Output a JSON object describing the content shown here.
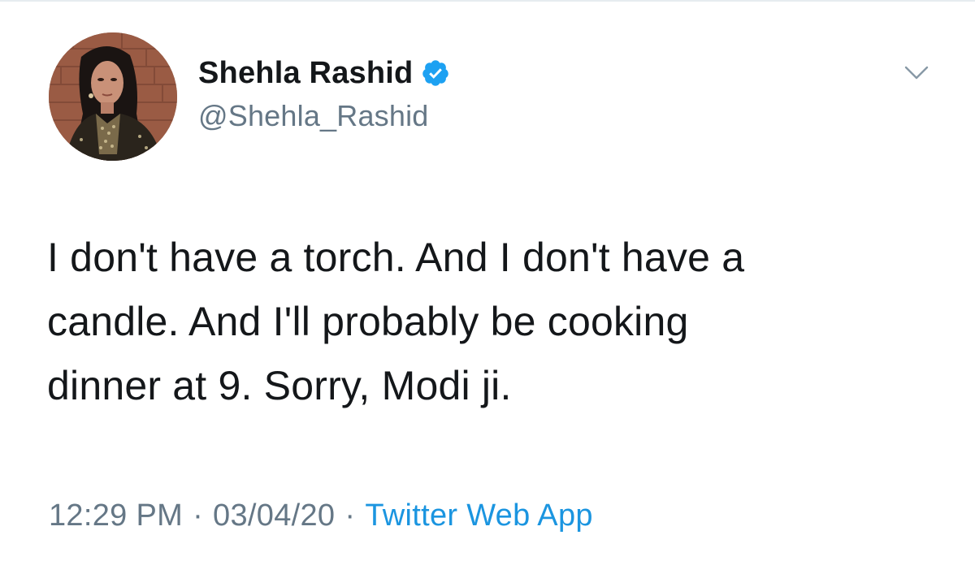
{
  "tweet": {
    "author": {
      "display_name": "Shehla Rashid",
      "handle": "@Shehla_Rashid",
      "verified": true
    },
    "text_lines": [
      "I don't have a torch. And I don't have a",
      "candle. And I'll probably be cooking",
      "dinner at 9. Sorry, Modi ji."
    ],
    "time": "12:29 PM",
    "separator": "·",
    "date": "03/04/20",
    "source": "Twitter Web App"
  },
  "icons": {
    "verified": "verified-badge-icon",
    "more": "chevron-down-icon"
  },
  "colors": {
    "text": "#14171a",
    "secondary": "#657786",
    "link": "#1b95e0",
    "verified": "#1da1f2"
  }
}
